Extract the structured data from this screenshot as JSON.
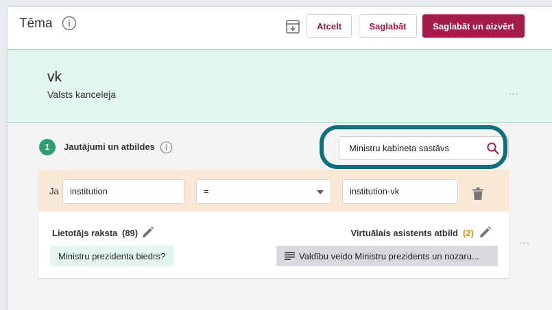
{
  "header": {
    "title": "Tēma",
    "cancel_label": "Atcelt",
    "save_label": "Saglabāt",
    "save_close_label": "Saglabāt un aizvērt"
  },
  "entity": {
    "code": "vk",
    "name": "Valsts kanceleja",
    "menu": "..."
  },
  "section": {
    "step": "1",
    "title": "Jautājumi un atbildes"
  },
  "search": {
    "value": "Ministru kabineta sastāvs"
  },
  "condition": {
    "prefix": "Ja",
    "field": "institution",
    "operator": "=",
    "value": "institution-vk"
  },
  "qa": {
    "user_label": "Lietotājs raksta",
    "user_count": "(89)",
    "assistant_label": "Virtuālais asistents atbild",
    "assistant_count": "(2)",
    "question": "Ministru prezidenta biedrs?",
    "answer": "Valdību veido Ministru prezidents un nozaru...",
    "menu": "..."
  },
  "colors": {
    "accent": "#a51c4c",
    "success": "#2e9e72",
    "highlight_ring": "#0e6f7d",
    "count_orange": "#e08a1e"
  }
}
